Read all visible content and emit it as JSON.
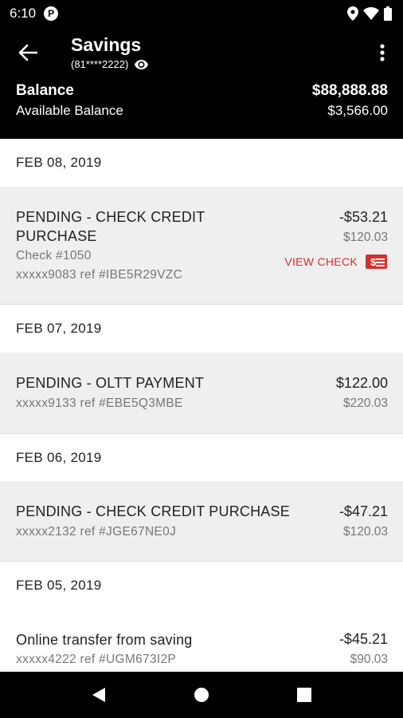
{
  "status_bar": {
    "time": "6:10",
    "notification_letter": "P"
  },
  "header": {
    "title": "Savings",
    "account_number": "(81****2222)",
    "balance_label": "Balance",
    "balance_value": "$88,888.88",
    "available_label": "Available Balance",
    "available_value": "$3,566.00"
  },
  "groups": [
    {
      "date": "FEB 08, 2019",
      "transactions": [
        {
          "description_line1": "PENDING - CHECK CREDIT",
          "description_line2": "PURCHASE",
          "check": "Check #1050",
          "reference": "xxxxx9083 ref #IBE5R29VZC",
          "amount": "-$53.21",
          "running_balance": "$120.03",
          "action_label": "VIEW CHECK"
        }
      ]
    },
    {
      "date": "FEB 07, 2019",
      "transactions": [
        {
          "description_line1": "PENDING - OLTT PAYMENT",
          "reference": "xxxxx9133 ref #EBE5Q3MBE",
          "amount": "$122.00",
          "running_balance": "$220.03"
        }
      ]
    },
    {
      "date": "FEB 06, 2019",
      "transactions": [
        {
          "description_line1": "PENDING - CHECK CREDIT PURCHASE",
          "reference": "xxxxx2132 ref #JGE67NE0J",
          "amount": "-$47.21",
          "running_balance": "$120.03"
        }
      ]
    },
    {
      "date": "FEB 05, 2019",
      "transactions": [
        {
          "description_line1": "Online transfer from saving",
          "reference": "xxxxx4222 ref #UGM673I2P",
          "amount": "-$45.21",
          "running_balance": "$90.03"
        }
      ]
    }
  ],
  "colors": {
    "accent_red": "#d32f2f",
    "header_bg": "#000000",
    "row_gray": "#efefef"
  }
}
